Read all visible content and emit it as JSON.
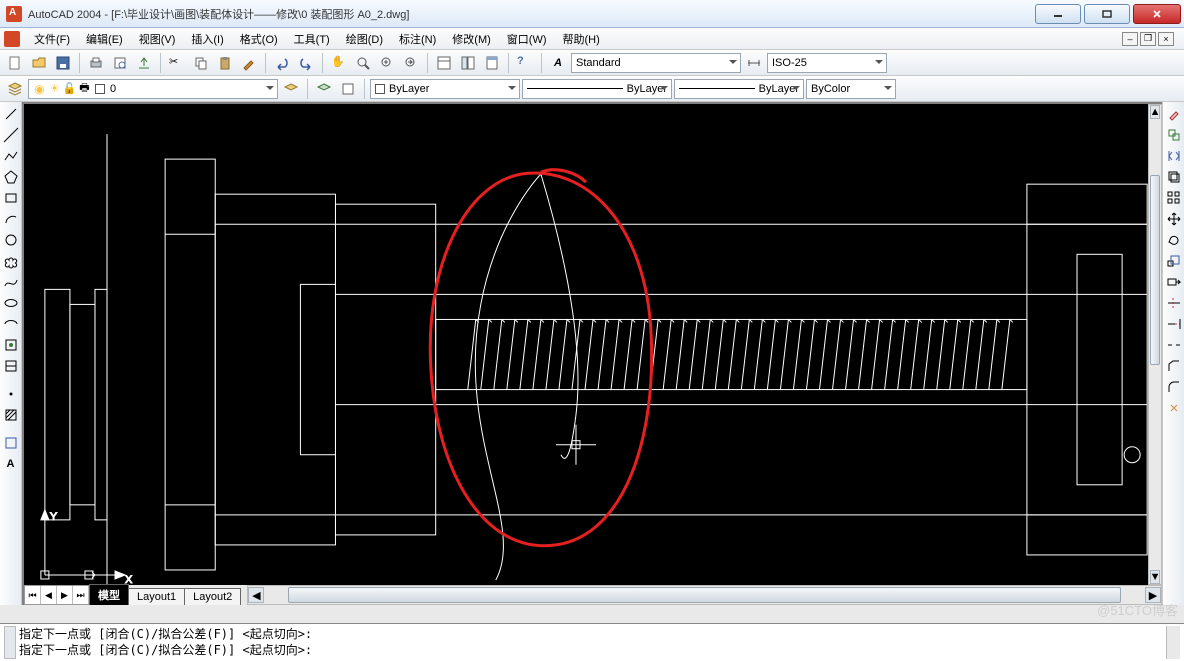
{
  "app_title": "AutoCAD 2004 - [F:\\毕业设计\\画图\\装配体设计——修改\\0 装配图形 A0_2.dwg]",
  "menu": [
    "文件(F)",
    "编辑(E)",
    "视图(V)",
    "插入(I)",
    "格式(O)",
    "工具(T)",
    "绘图(D)",
    "标注(N)",
    "修改(M)",
    "窗口(W)",
    "帮助(H)"
  ],
  "style_drop": "Standard",
  "dim_drop": "ISO-25",
  "layer_name": "0",
  "linetype": "ByLayer",
  "lineweight": "ByLayer",
  "linetype2": "ByLayer",
  "color_mode": "ByColor",
  "tabs": {
    "active": "模型",
    "others": [
      "Layout1",
      "Layout2"
    ]
  },
  "command_lines": [
    "指定下一点或 [闭合(C)/拟合公差(F)] <起点切向>:",
    "指定下一点或 [闭合(C)/拟合公差(F)] <起点切向>:"
  ],
  "watermark": "@51CTO博客",
  "ucs": {
    "x": "X",
    "y": "Y"
  }
}
